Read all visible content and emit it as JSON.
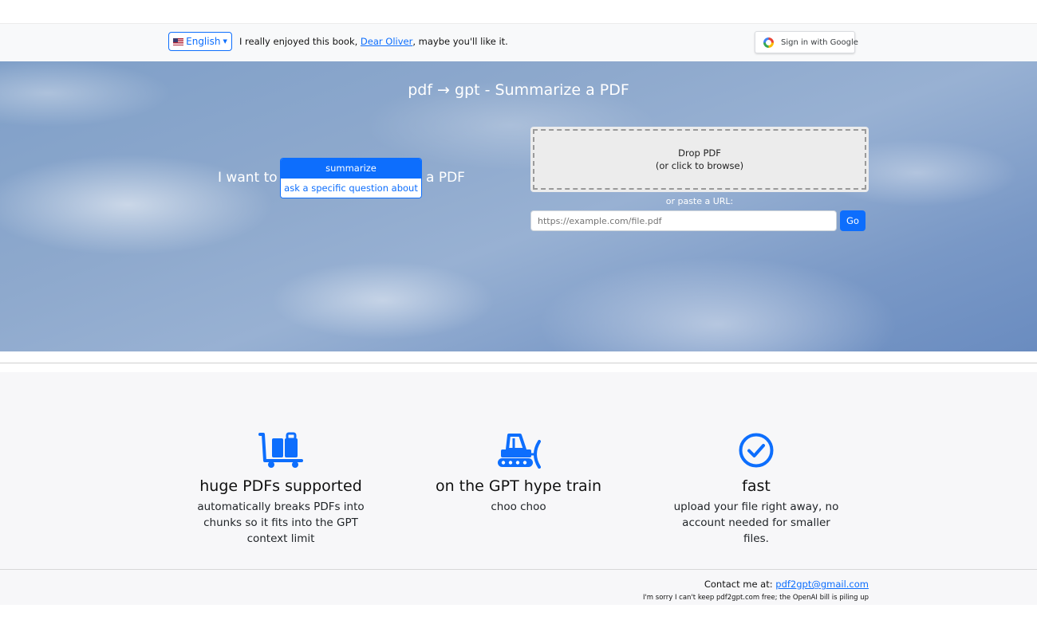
{
  "topbar": {
    "language_label": "English",
    "tagline_prefix": "I really enjoyed this book, ",
    "tagline_link": "Dear Oliver",
    "tagline_suffix": ", maybe you'll like it.",
    "google_button_label": "Sign in with Google"
  },
  "hero": {
    "title": "pdf → gpt - Summarize a PDF",
    "i_want_label": "I want to",
    "options": [
      "summarize",
      "ask a specific question about"
    ],
    "selected_option": "summarize",
    "a_pdf_label": "a PDF",
    "dropzone_line1": "Drop PDF",
    "dropzone_line2": "(or click to browse)",
    "or_paste_label": "or paste a URL:",
    "url_placeholder": "https://example.com/file.pdf",
    "go_label": "Go"
  },
  "features": [
    {
      "icon": "luggage-cart-icon",
      "title": "huge PDFs supported",
      "description": "automatically breaks PDFs into chunks so it fits into the GPT context limit"
    },
    {
      "icon": "snowplow-icon",
      "title": "on the GPT hype train",
      "description": "choo choo"
    },
    {
      "icon": "check-circle-icon",
      "title": "fast",
      "description": "upload your file right away, no account needed for smaller files."
    }
  ],
  "footer": {
    "contact_prefix": "Contact me at: ",
    "contact_email": "pdf2gpt@gmail.com",
    "note": "I'm sorry I can't keep pdf2gpt.com free; the OpenAI bill is piling up"
  },
  "colors": {
    "accent": "#0d6efd",
    "feature_bg": "#f7f7f9",
    "topbar_bg": "#f8f9fa"
  }
}
